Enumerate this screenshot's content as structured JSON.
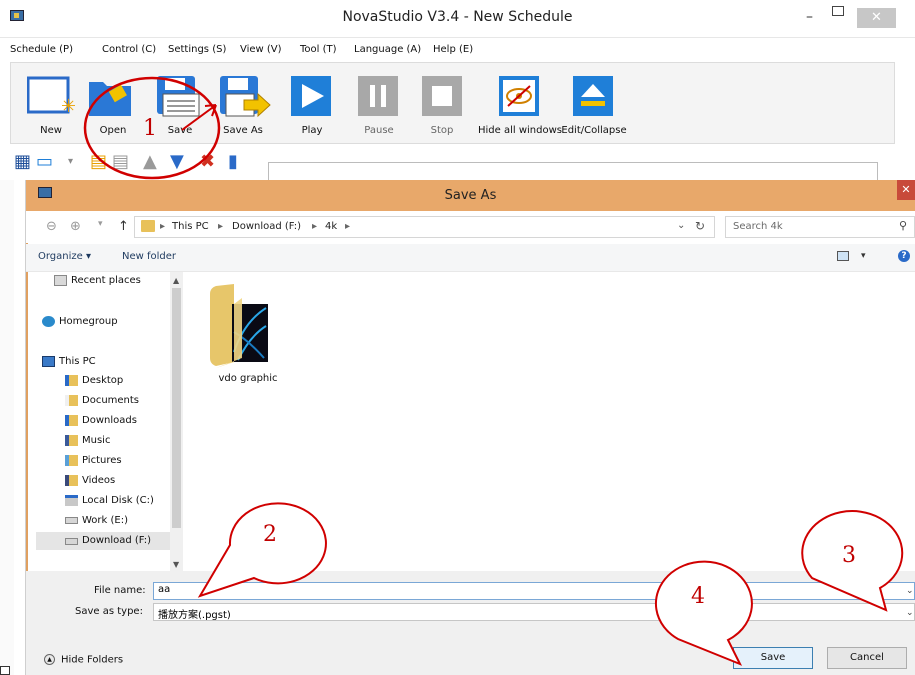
{
  "app": {
    "title": "NovaStudio V3.4 - New Schedule",
    "minimize": "–",
    "close": "✕",
    "menu": [
      "Schedule (P)",
      "Control (C)",
      "Settings (S)",
      "View (V)",
      "Tool (T)",
      "Language (A)",
      "Help (E)"
    ],
    "toolbar": [
      {
        "label": "New",
        "icon": "new-schedule-icon"
      },
      {
        "label": "Open",
        "icon": "open-folder-icon"
      },
      {
        "label": "Save",
        "icon": "save-icon"
      },
      {
        "label": "Save As",
        "icon": "save-as-icon"
      },
      {
        "label": "Play",
        "icon": "play-icon"
      },
      {
        "label": "Pause",
        "icon": "pause-icon"
      },
      {
        "label": "Stop",
        "icon": "stop-icon"
      },
      {
        "label": "Hide all windows",
        "icon": "hide-windows-icon"
      },
      {
        "label": "Edit/Collapse",
        "icon": "eject-icon"
      }
    ]
  },
  "dialog": {
    "title": "Save As",
    "close": "✕",
    "breadcrumb": [
      "This PC",
      "Download (F:)",
      "4k"
    ],
    "search_placeholder": "Search 4k",
    "organize": "Organize ▾",
    "new_folder": "New folder",
    "nav_items": [
      {
        "label": "Recent places",
        "icon": "recent-places-icon"
      },
      {
        "label": "Homegroup",
        "icon": "homegroup-icon"
      },
      {
        "label": "This PC",
        "icon": "computer-icon"
      },
      {
        "label": "Desktop",
        "icon": "desktop-folder-icon"
      },
      {
        "label": "Documents",
        "icon": "documents-folder-icon"
      },
      {
        "label": "Downloads",
        "icon": "downloads-folder-icon"
      },
      {
        "label": "Music",
        "icon": "music-folder-icon"
      },
      {
        "label": "Pictures",
        "icon": "pictures-folder-icon"
      },
      {
        "label": "Videos",
        "icon": "videos-folder-icon"
      },
      {
        "label": "Local Disk (C:)",
        "icon": "local-disk-icon"
      },
      {
        "label": "Work (E:)",
        "icon": "drive-icon"
      },
      {
        "label": "Download (F:)",
        "icon": "drive-icon",
        "selected": true
      }
    ],
    "folder_name": "vdo graphic",
    "file_name_label": "File name:",
    "file_name_value": "aa",
    "save_type_label": "Save as type:",
    "save_type_value": "播放方案(.pgst)",
    "hide_folders": "Hide Folders",
    "save_button": "Save",
    "cancel_button": "Cancel"
  },
  "annotations": [
    "1",
    "2",
    "3",
    "4"
  ],
  "colors": {
    "dialog_title": "#e8a86a",
    "annotation": "#c00000",
    "play_blue": "#1f7fd8"
  }
}
